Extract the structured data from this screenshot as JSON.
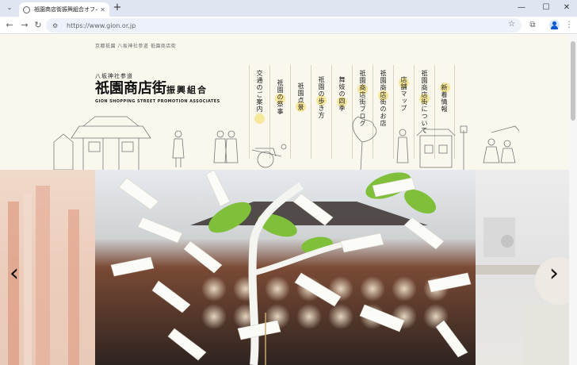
{
  "browser": {
    "tab_title": "祇園商店街振興組合オフィシャルサイト",
    "url": "https://www.gion.or.jp"
  },
  "site": {
    "breadcrumb": "京都祇園 八坂神社参道 祇園商店街",
    "logo_sub": "八坂神社参道",
    "logo_main": "祇園商店街",
    "logo_main_small": "振興組合",
    "logo_en": "GION SHOPPING STREET PROMOTION ASSOCIATES"
  },
  "nav": {
    "items": [
      {
        "label": "交通のご案内"
      },
      {
        "label": "祇園の祭事"
      },
      {
        "label": "祇園点景"
      },
      {
        "label": "祇園の歩き方"
      },
      {
        "label": "舞妓の四季"
      },
      {
        "label": "祇園商店街ブログ"
      },
      {
        "label": "祇園商店街のお店"
      },
      {
        "label": "店舗マップ"
      },
      {
        "label": "祇園商店街について"
      },
      {
        "label": "新着情報"
      }
    ]
  },
  "carousel": {
    "prev": "‹",
    "next": "›"
  }
}
